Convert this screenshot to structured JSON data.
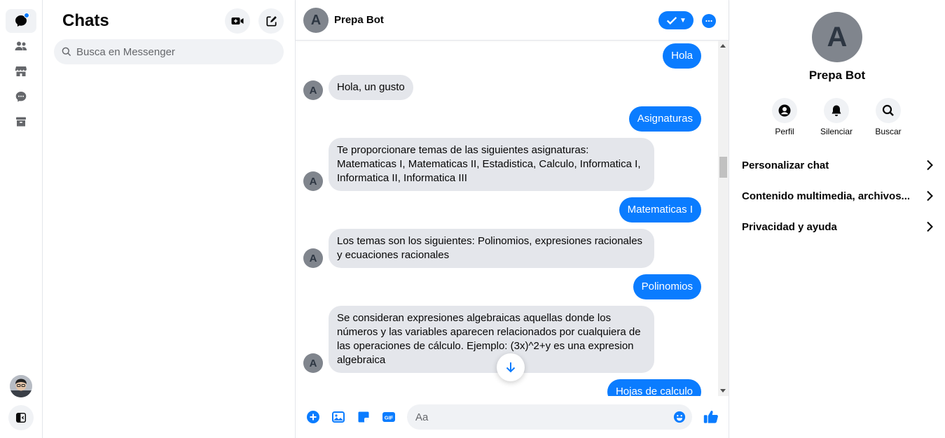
{
  "rail": {
    "items": [
      "chats-icon",
      "people-icon",
      "marketplace-icon",
      "requests-icon",
      "archive-icon"
    ]
  },
  "chats": {
    "title": "Chats",
    "search_placeholder": "Busca en Messenger"
  },
  "conversation": {
    "contact_name": "Prepa Bot",
    "avatar_letter": "A",
    "messages": [
      {
        "from": "me",
        "text": "Hola"
      },
      {
        "from": "bot",
        "text": "Hola, un gusto"
      },
      {
        "from": "me",
        "text": "Asignaturas"
      },
      {
        "from": "bot",
        "text": "Te proporcionare temas de las siguientes asignaturas: Matematicas I, Matematicas II, Estadistica, Calculo, Informatica I, Informatica II, Informatica III"
      },
      {
        "from": "me",
        "text": "Matematicas I"
      },
      {
        "from": "bot",
        "text": "Los temas son los siguientes: Polinomios, expresiones racionales y ecuaciones racionales"
      },
      {
        "from": "me",
        "text": "Polinomios"
      },
      {
        "from": "bot",
        "text": "Se consideran expresiones algebraicas aquellas donde los números y las variables aparecen relacionados por cualquiera de las operaciones de cálculo. Ejemplo: (3x)^2+y es una expresion algebraica"
      },
      {
        "from": "me",
        "text": "Hojas de calculo"
      }
    ],
    "composer_placeholder": "Aa"
  },
  "info": {
    "name": "Prepa Bot",
    "avatar_letter": "A",
    "actions": [
      {
        "label": "Perfil",
        "icon": "profile-icon"
      },
      {
        "label": "Silenciar",
        "icon": "bell-icon"
      },
      {
        "label": "Buscar",
        "icon": "search-icon"
      }
    ],
    "rows": [
      {
        "label": "Personalizar chat"
      },
      {
        "label": "Contenido multimedia, archivos..."
      },
      {
        "label": "Privacidad y ayuda"
      }
    ]
  },
  "colors": {
    "accent": "#0a7cff",
    "bubble_in": "#e4e6eb",
    "surface": "#f0f2f5"
  }
}
